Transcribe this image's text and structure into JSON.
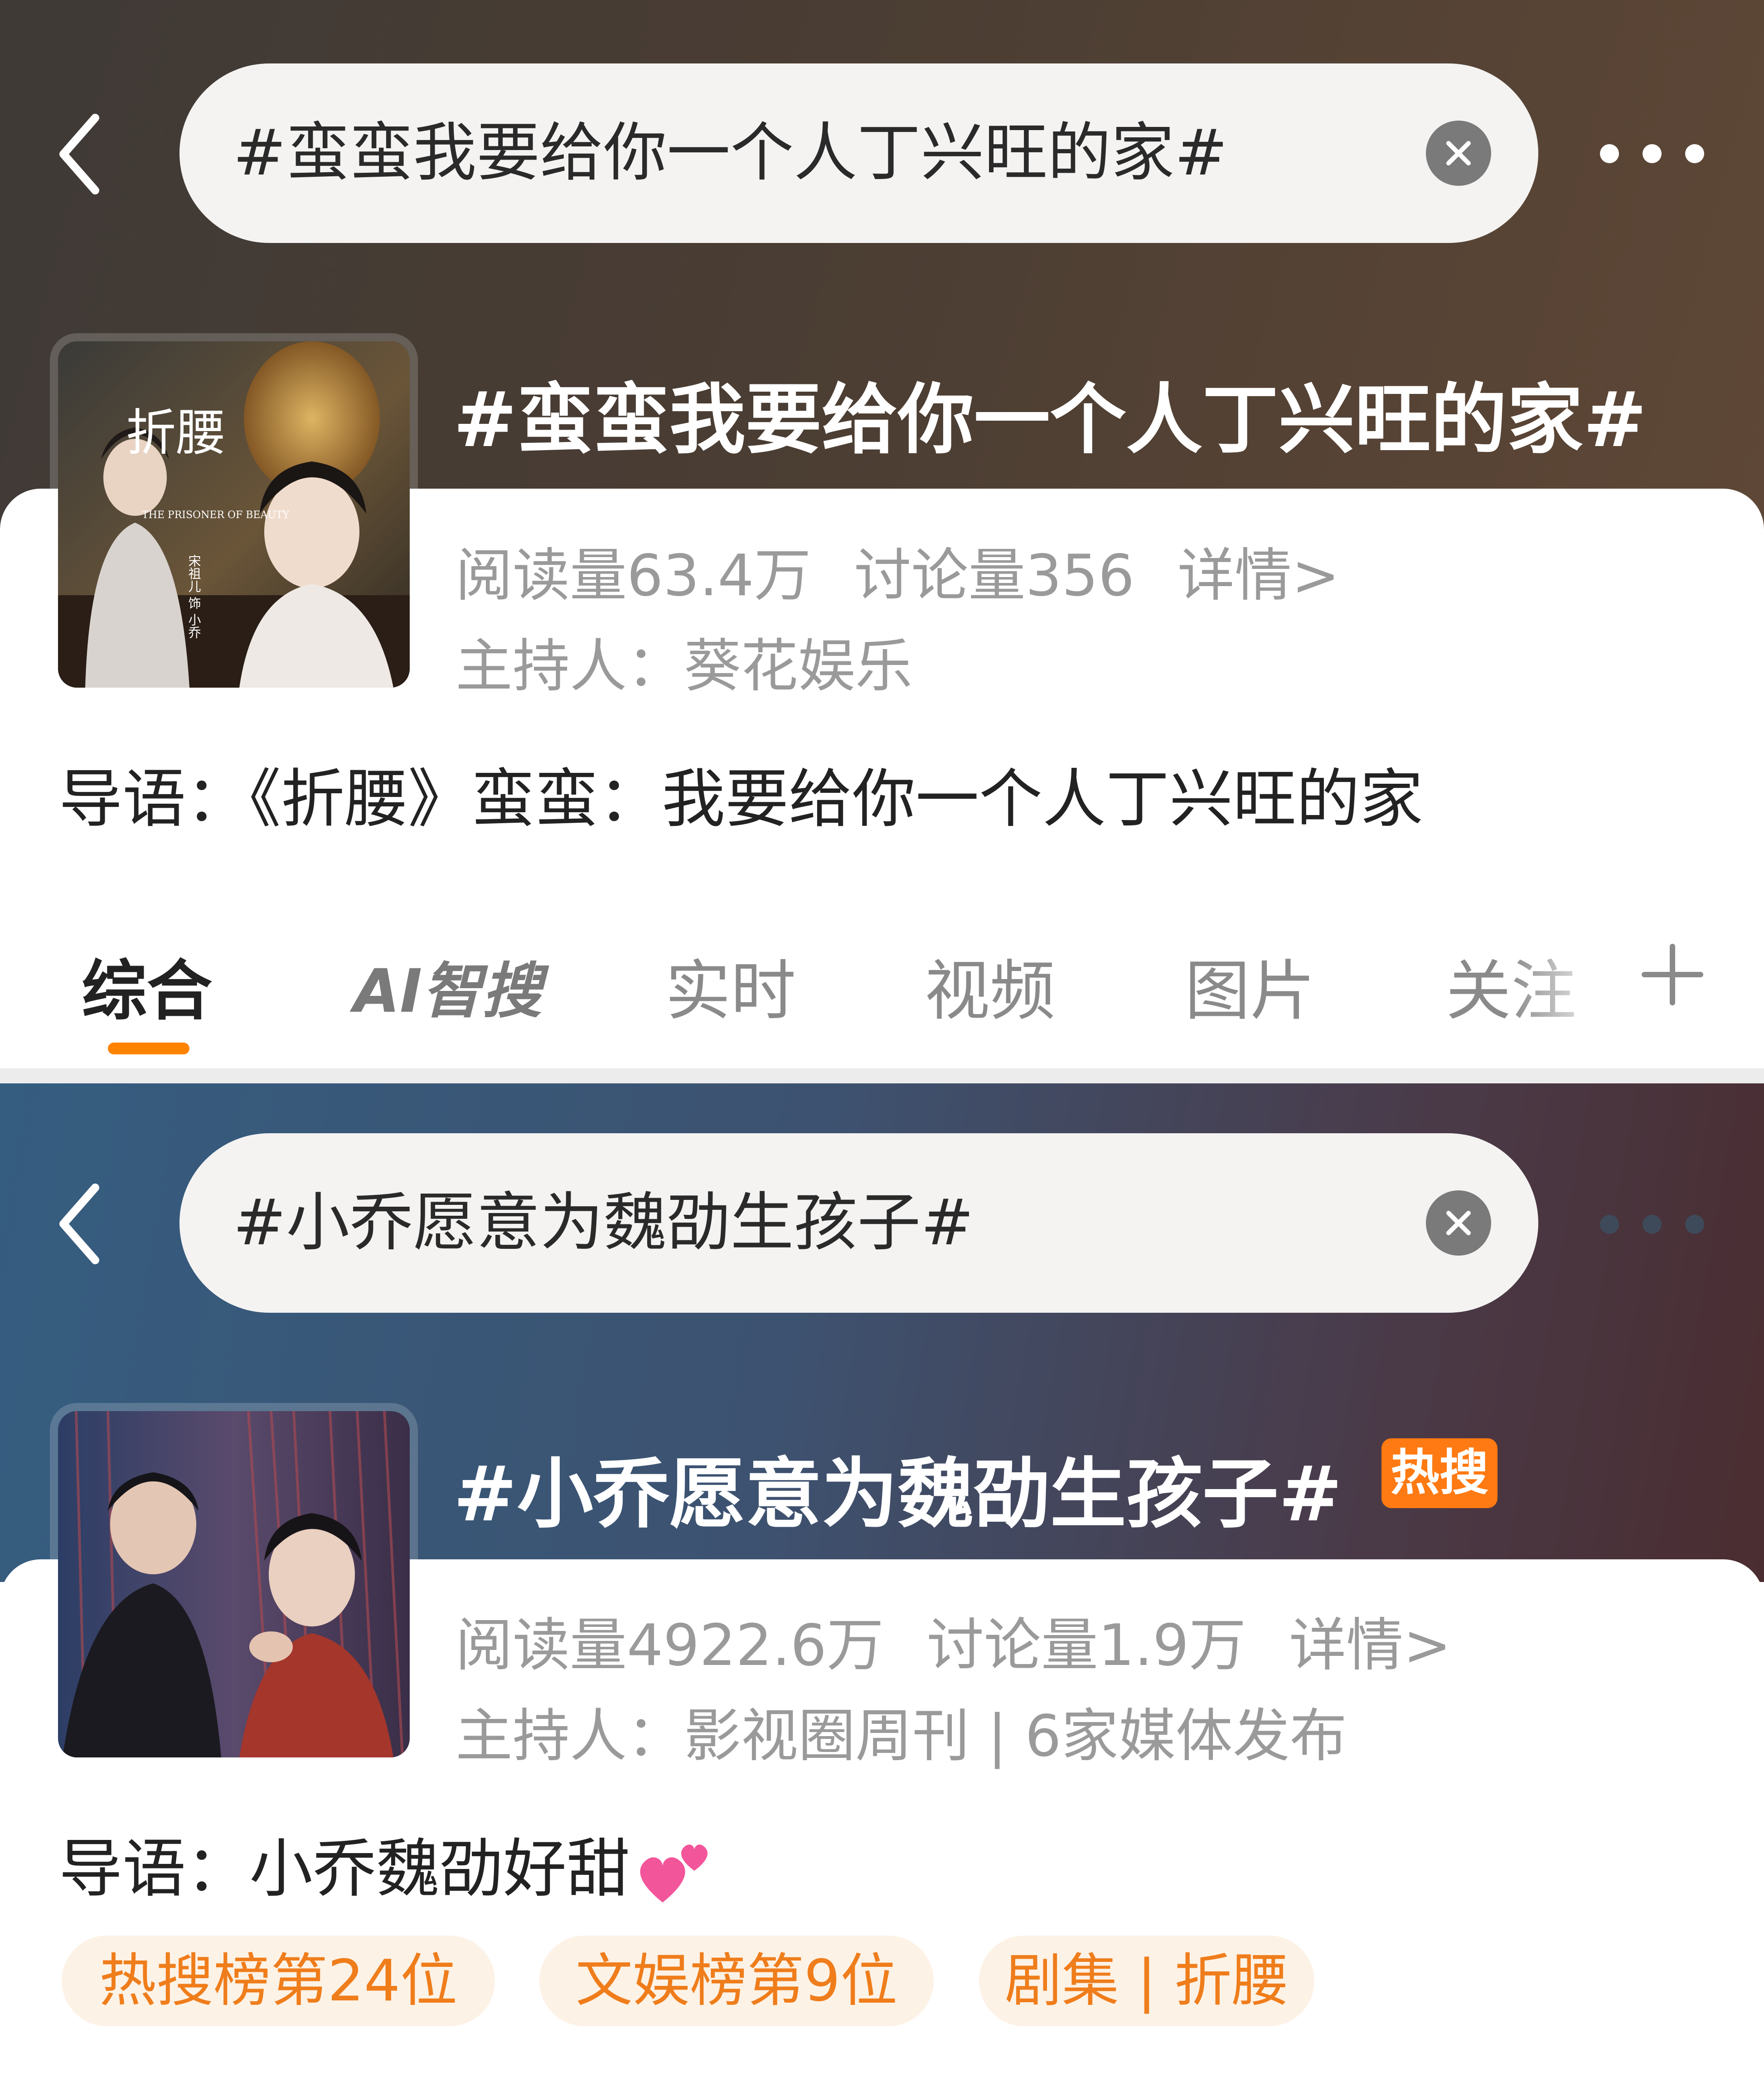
{
  "panels": [
    {
      "search_query": "#蛮蛮我要给你一个人丁兴旺的家#",
      "topic_title": "#蛮蛮我要给你一个人丁兴旺的家#",
      "stats": {
        "reads": "阅读量63.4万",
        "discussions": "讨论量356",
        "details": "详情>"
      },
      "host": "主持人：葵花娱乐",
      "guide": "导语：《折腰》蛮蛮：我要给你一个人丁兴旺的家",
      "thumb_text": {
        "title": "折腰",
        "subtitle": "THE PRISONER OF BEAUTY",
        "cast": "宋祖儿 饰 小乔"
      },
      "tabs": [
        {
          "label": "综合",
          "active": true
        },
        {
          "label": "AI智搜",
          "active": false
        },
        {
          "label": "实时",
          "active": false
        },
        {
          "label": "视频",
          "active": false
        },
        {
          "label": "图片",
          "active": false
        },
        {
          "label": "关注",
          "active": false
        }
      ]
    },
    {
      "search_query": "#小乔愿意为魏劭生孩子#",
      "topic_title": "#小乔愿意为魏劭生孩子#",
      "hot_badge": "热搜",
      "stats": {
        "reads": "阅读量4922.6万",
        "discussions": "讨论量1.9万",
        "details": "详情>"
      },
      "host": "主持人：影视圈周刊 | 6家媒体发布",
      "guide": "导语：小乔魏劭好甜",
      "guide_emoji": "two-hearts",
      "pills": [
        "热搜榜第24位",
        "文娱榜第9位",
        "剧集 | 折腰"
      ]
    }
  ],
  "colors": {
    "accent_orange": "#ff8200",
    "hot_badge": "#ff7a12",
    "pill_bg": "#fdf2e6",
    "pill_text": "#ef7d1b",
    "muted_text": "#9a9a9a"
  },
  "icons": [
    "back-arrow-icon",
    "clear-icon",
    "more-icon",
    "plus-icon",
    "two-hearts-icon"
  ]
}
